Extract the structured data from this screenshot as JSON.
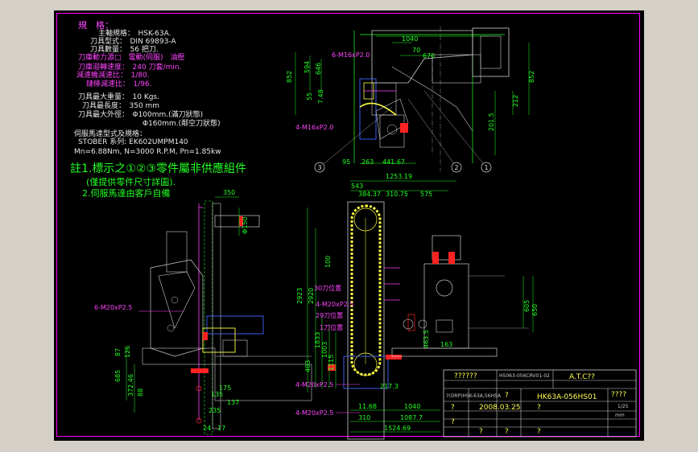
{
  "specs": {
    "title": "規　格：",
    "spindle": "主軸規格：　HSK-63A.",
    "tool_type": "刀具型式：　DIN 69893-A",
    "tool_qty": "刀具數量：　56 把刀.",
    "drive": "刀庫動力源□　電動(伺服)　油壓",
    "mag_speed": "刀庫迴轉速度：　240 刀套/min.",
    "reducer_ratio": "減速機減速比：　1/80.",
    "chain_ratio": "鏈條減速比：　1/96.",
    "max_weight": "刀具最大重量：　10 Kgs.",
    "max_length": "刀具最長度：　350 mm",
    "max_dia_full": "刀具最大外徑：　Φ100mm.(滿刀狀態)",
    "max_dia_empty": "Φ160mm.(鄰空刀狀態)",
    "servo_label": "伺服馬達型式及規格：",
    "servo_series": "STOBER 系列: EK602UMPM140",
    "servo_spec": "Mn=6.88Nm, N=3000 R.P.M, Pn=1.85kw",
    "note1": "註1.標示之①②③零件屬非供應組件",
    "note1b": "(僅提供零件尺寸詳圖).",
    "note2": "2.伺服馬達由客戶自備"
  },
  "dims_top": {
    "d1040": "1040",
    "d70": "70",
    "d670": "670",
    "d852l": "852",
    "d852r": "852",
    "d594": "594",
    "d646": "646",
    "d212": "212",
    "d201": "201.5",
    "d55": "55",
    "d748": "7.48",
    "d95": "95",
    "d263": "263",
    "d441": "441.67",
    "thread_top": "6-M16xP2.0",
    "thread_bot": "4-M16xP2.0",
    "b1": "1",
    "b2": "2",
    "b3": "3"
  },
  "dims_left": {
    "d350": "350",
    "d150": "Φ150",
    "thread": "6-M20xP2.5",
    "d87": "87",
    "d126": "126",
    "d685": "685",
    "d372": "372.46",
    "d88": "88",
    "d175": "175",
    "d135": "135",
    "d137": "137",
    "d235": "235",
    "d24": "24",
    "d17": "17"
  },
  "dims_mid": {
    "d1253": "1253.19",
    "d543": "543",
    "d384": "384.37",
    "d310": "310.75",
    "d575": "575",
    "d100": "100",
    "d2923": "2923",
    "d2920": "2920",
    "d1833": "1833",
    "d1003": "1003",
    "d403": "403",
    "d1115": "1115",
    "d217": "217.3",
    "d1040": "1040",
    "d1087": "1087.7",
    "d1524": "1524.69",
    "d1168": "11.68",
    "d310b": "310",
    "d605": "605",
    "d650": "650",
    "d463": "463.5",
    "d163": "163",
    "thread_a": "4-M20xP2.5",
    "thread_b": "4-M20xP2.5",
    "thread_c": "4-M20xP2.5",
    "label_a": "30刀位置",
    "label_b": "29刀位置",
    "label_c": "1刀位置"
  },
  "title_block": {
    "r1c1": "??????",
    "r1c2": "HS063-056CRV01-02",
    "r1c3": "A.T.C??",
    "r2c1": "?(ORP)HSK-63A,56HSA",
    "r2c2": "?",
    "r2c3": "HK63A-056HS01",
    "r2c4": "????",
    "scale": "1/25",
    "date": "2008.03.25",
    "q1": "?",
    "q2": "?",
    "q3": "?",
    "q4": "?",
    "q5": "?",
    "q6": "?",
    "unit": "mm"
  }
}
